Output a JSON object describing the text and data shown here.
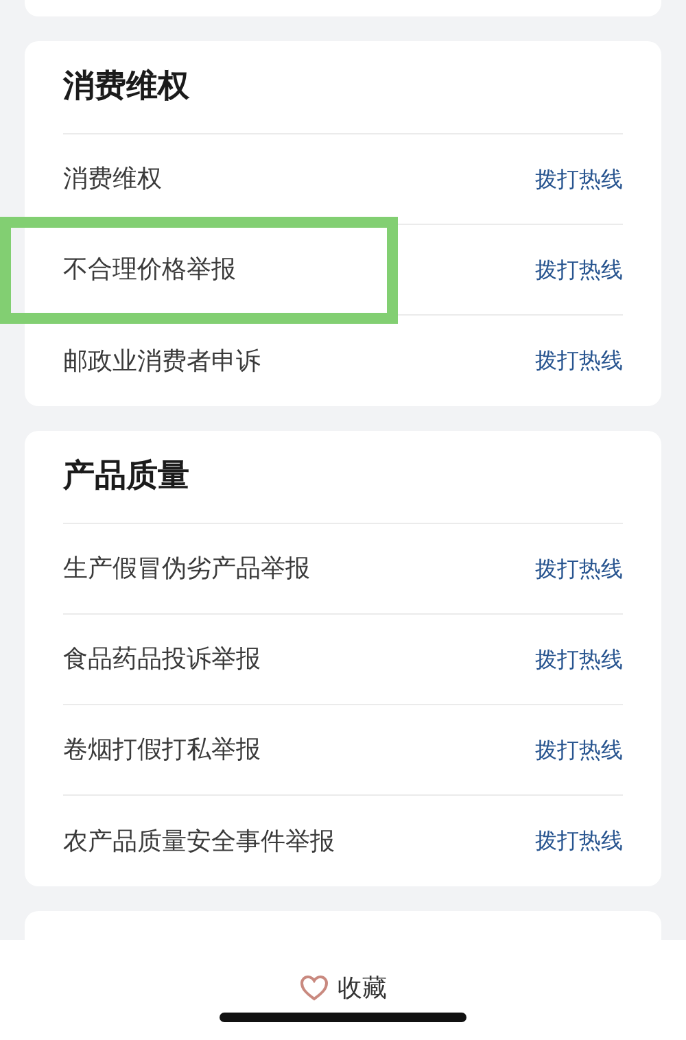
{
  "sections": [
    {
      "title": "消费维权",
      "items": [
        {
          "label": "消费维权",
          "action": "拨打热线",
          "highlighted": false
        },
        {
          "label": "不合理价格举报",
          "action": "拨打热线",
          "highlighted": true
        },
        {
          "label": "邮政业消费者申诉",
          "action": "拨打热线",
          "highlighted": false
        }
      ]
    },
    {
      "title": "产品质量",
      "items": [
        {
          "label": "生产假冒伪劣产品举报",
          "action": "拨打热线",
          "highlighted": false
        },
        {
          "label": "食品药品投诉举报",
          "action": "拨打热线",
          "highlighted": false
        },
        {
          "label": "卷烟打假打私举报",
          "action": "拨打热线",
          "highlighted": false
        },
        {
          "label": "农产品质量安全事件举报",
          "action": "拨打热线",
          "highlighted": false
        }
      ]
    }
  ],
  "bottom_bar": {
    "favorite_label": "收藏"
  }
}
